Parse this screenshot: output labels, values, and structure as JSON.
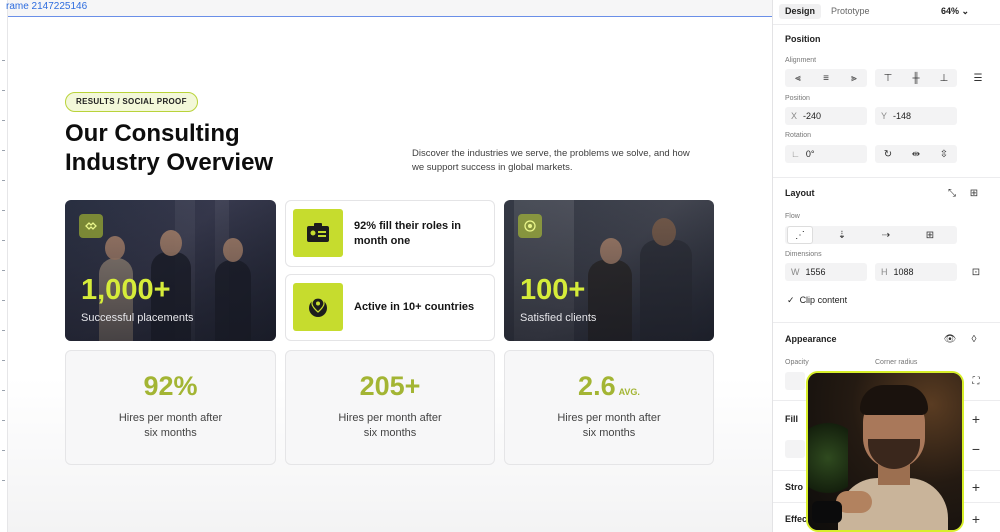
{
  "canvas": {
    "frame_label": "rame 2147225146",
    "badge": "RESULTS / SOCIAL PROOF",
    "title_line1": "Our Consulting",
    "title_line2": "Industry Overview",
    "subtitle_line1": "Discover the industries we serve, the problems we solve, and how",
    "subtitle_line2": "we support success in global markets.",
    "photo_cards": [
      {
        "value": "1,000+",
        "caption": "Successful placements",
        "icon": "handshake-icon"
      },
      {
        "value": "100+",
        "caption": "Satisfied clients",
        "icon": "target-icon"
      }
    ],
    "mini_cards": [
      {
        "line1": "92% fill their roles in",
        "line2": "month one",
        "icon": "id-card-icon"
      },
      {
        "line1": "Active in 10+ countries",
        "line2": "",
        "icon": "globe-location-icon"
      }
    ],
    "stats": [
      {
        "value": "92%",
        "suffix": "",
        "line1": "Hires per month after",
        "line2": "six months"
      },
      {
        "value": "205+",
        "suffix": "",
        "line1": "Hires per month after",
        "line2": "six months"
      },
      {
        "value": "2.6",
        "suffix": "AVG.",
        "line1": "Hires per month after",
        "line2": "six months"
      }
    ],
    "colors": {
      "accent": "#c6dc2e",
      "accent_text": "#a3b534",
      "photo_value": "#d6ec3a"
    }
  },
  "panel": {
    "tabs": {
      "design": "Design",
      "prototype": "Prototype"
    },
    "zoom": "64%",
    "position": {
      "title": "Position",
      "alignment_label": "Alignment",
      "position_label": "Position",
      "x_prefix": "X",
      "x_value": "-240",
      "y_prefix": "Y",
      "y_value": "-148",
      "rotation_label": "Rotation",
      "rotation_value": "0°"
    },
    "layout": {
      "title": "Layout",
      "flow_label": "Flow",
      "dimensions_label": "Dimensions",
      "w_prefix": "W",
      "w_value": "1556",
      "h_prefix": "H",
      "h_value": "1088",
      "clip_content": "Clip content"
    },
    "appearance": {
      "title": "Appearance",
      "opacity_label": "Opacity",
      "corner_radius_label": "Corner radius"
    },
    "fill": {
      "title": "Fill"
    },
    "stroke": {
      "title": "Stro"
    },
    "effects": {
      "title": "Effec"
    }
  }
}
